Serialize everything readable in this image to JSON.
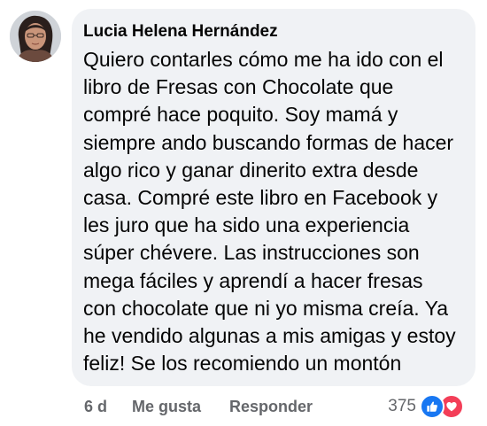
{
  "comment": {
    "author": "Lucia Helena Hernández",
    "text_lines": [
      "Quiero contarles cómo me ha ido con el",
      "libro de Fresas con Chocolate que",
      "compré hace poquito. Soy mamá y",
      "siempre ando buscando formas de hacer",
      "algo rico y ganar dinerito extra desde",
      "casa. Compré este libro en Facebook y",
      "les juro que ha sido una experiencia",
      "súper chévere. Las instrucciones son",
      "mega fáciles y aprendí a hacer fresas",
      "con chocolate que ni yo misma creía. Ya",
      "he vendido algunas a mis amigas y estoy",
      "feliz! Se los recomiendo un montón"
    ]
  },
  "actions": {
    "time": "6 d",
    "like_label": "Me gusta",
    "reply_label": "Responder"
  },
  "reactions": {
    "count": "375",
    "icons": [
      "like-icon",
      "love-icon"
    ],
    "colors": {
      "like": "#1877f2",
      "love": "#f33e58"
    }
  },
  "colors": {
    "bubble": "#f0f2f5",
    "text": "#050505",
    "secondary": "#65676b"
  }
}
